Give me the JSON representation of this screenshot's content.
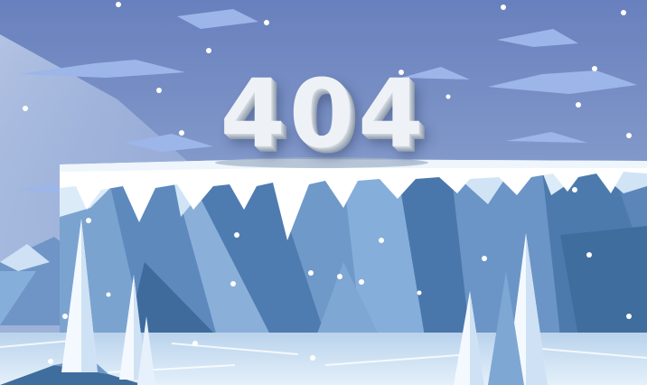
{
  "error": {
    "code": "404"
  },
  "colors": {
    "sky_top": "#6a84c0",
    "sky_bottom": "#9db3d9",
    "cloud": "#9fb9ec",
    "cliff_light": "#7fa7d3",
    "cliff_dark": "#3f6d9e",
    "snow": "#ffffff",
    "ice_floor": "#cfe3f4",
    "tree": "#f4f9ff"
  },
  "icons": [
    "cloud-icon",
    "snowflake-icon",
    "pine-tree-icon"
  ]
}
